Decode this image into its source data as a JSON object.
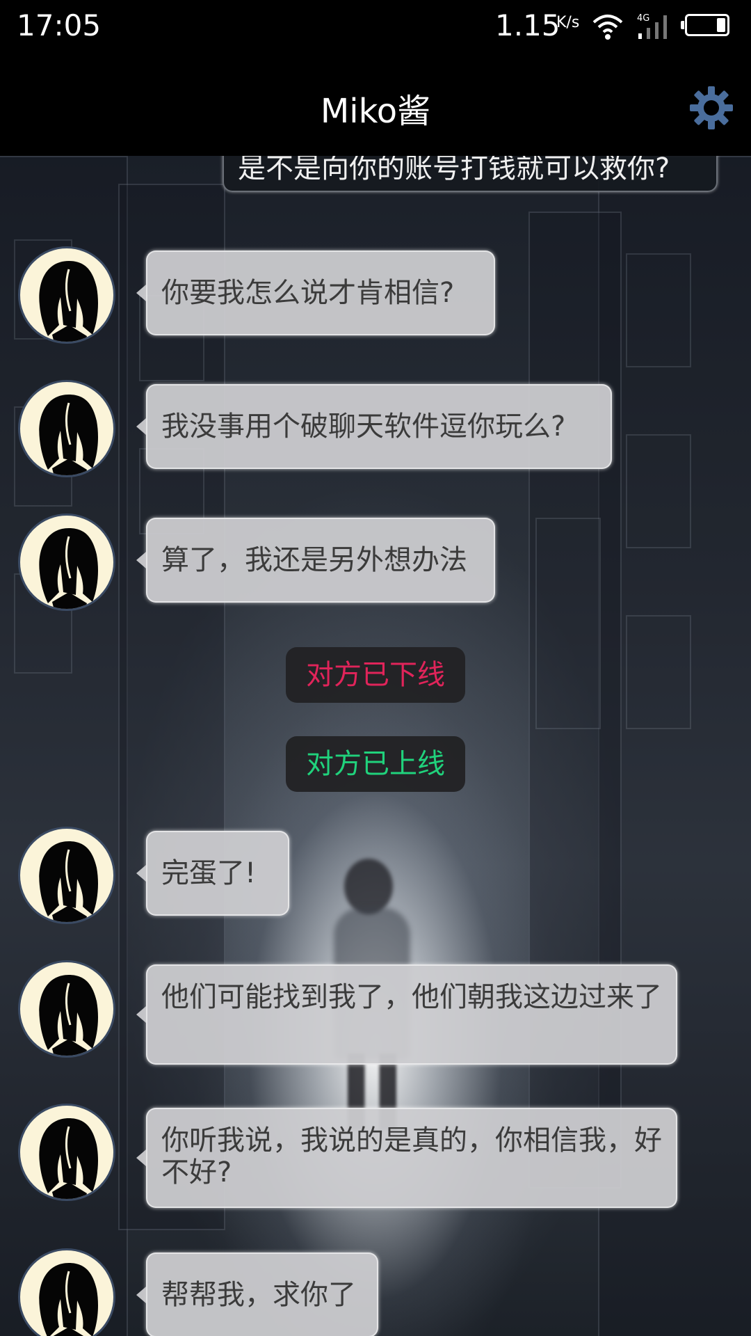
{
  "status_bar": {
    "time": "17:05",
    "network_speed": "1.15",
    "network_speed_unit": "K/s",
    "signal_label": "4G"
  },
  "header": {
    "title": "Miko酱",
    "settings_icon": "gear-icon",
    "accent_color": "#4a6d9c"
  },
  "messages": [
    {
      "type": "sent",
      "text": "是不是向你的账号打钱就可以救你?"
    },
    {
      "type": "received",
      "text": "你要我怎么说才肯相信?"
    },
    {
      "type": "received",
      "text": "我没事用个破聊天软件逗你玩么?"
    },
    {
      "type": "received",
      "text": "算了，我还是另外想办法"
    },
    {
      "type": "system",
      "text": "对方已下线",
      "color": "#e0245a"
    },
    {
      "type": "system",
      "text": "对方已上线",
      "color": "#20d27c"
    },
    {
      "type": "received",
      "text": "完蛋了!"
    },
    {
      "type": "received",
      "text": "他们可能找到我了，他们朝我这边过来了"
    },
    {
      "type": "received",
      "text": "你听我说，我说的是真的，你相信我，好不好?"
    },
    {
      "type": "received",
      "text": "帮帮我，求你了"
    }
  ]
}
